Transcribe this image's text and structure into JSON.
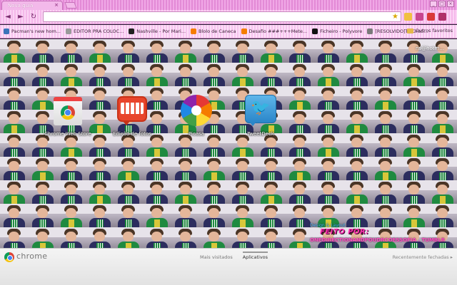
{
  "window": {
    "tab_title": "Nova guia",
    "tab_close": "×",
    "controls": [
      "_",
      "□",
      "×"
    ]
  },
  "toolbar": {
    "back": "◄",
    "forward": "►",
    "reload": "↻",
    "address_value": "",
    "address_placeholder": ""
  },
  "bookmarks": [
    {
      "label": "Pacman's new hom...",
      "icon": "globe-icon",
      "color": "#3b73b9"
    },
    {
      "label": "EDITOR PRA COLOC...",
      "icon": "page-icon",
      "color": "#9a9a9a"
    },
    {
      "label": "Nashville - Por Mari...",
      "icon": "ff-icon",
      "color": "#222222"
    },
    {
      "label": "Blolo de Caneca",
      "icon": "blogger-icon",
      "color": "#f57d00"
    },
    {
      "label": "Desafio ###+++Mete...",
      "icon": "blogger-icon",
      "color": "#f57d00"
    },
    {
      "label": "Ficheiro - Polyvore",
      "icon": "polyvore-icon",
      "color": "#111111"
    },
    {
      "label": "[RESOLVIDO]Tv Grati...",
      "icon": "page-icon",
      "color": "#7a7a7a"
    }
  ],
  "other_bookmarks": "Outros favoritos",
  "apps": [
    {
      "label": "Chrome Web Store",
      "icon": "chrome-web-store-icon"
    },
    {
      "label": "Edição de fotos",
      "icon": "photo-editor-icon"
    },
    {
      "label": "Picasa",
      "icon": "picasa-icon"
    },
    {
      "label": "TweetDeck",
      "icon": "tweetdeck-icon"
    }
  ],
  "overlay": {
    "email_peek": "ns@hotm...",
    "credit_top": "Design & Layout",
    "credit_title": "FEITO POR:",
    "credit_url": "ONEDIRECTIONANDPOUDRCOESSOFIA . TUMBLR"
  },
  "footer": {
    "brand": "chrome",
    "tabs": [
      {
        "label": "Mais visitados",
        "active": false
      },
      {
        "label": "Aplicativos",
        "active": true
      }
    ],
    "recent": "Recentemente fechadas ▸"
  },
  "colors": {
    "tab_strip_pink": "#e38ad6",
    "toolbar_pink": "#f4b8ea",
    "credit_pink": "#ff2fb0",
    "credit_blue": "#4fb8ff"
  }
}
